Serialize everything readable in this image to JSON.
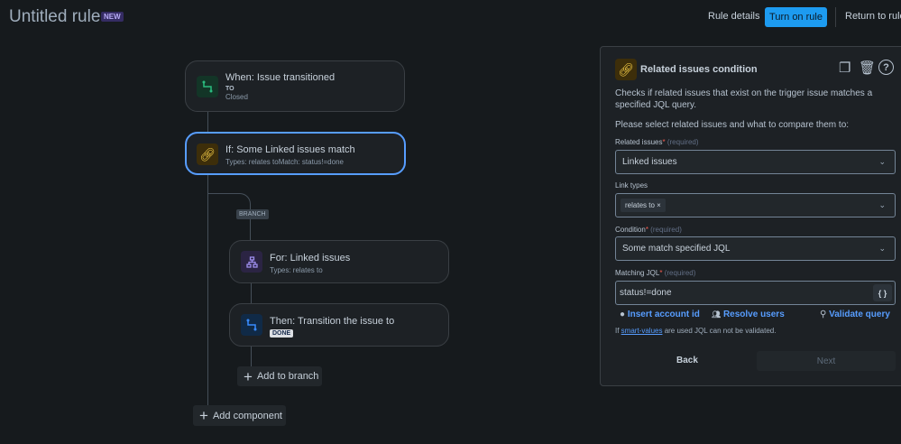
{
  "header": {
    "title": "Untitled rule",
    "badge": "NEW",
    "rule_details": "Rule details",
    "turn_on": "Turn on rule",
    "return": "Return to rules"
  },
  "flow": {
    "trigger": {
      "title": "When: Issue transitioned",
      "sub1": "TO",
      "sub2": "Closed"
    },
    "condition": {
      "title": "If: Some Linked issues match",
      "sub": "Types: relates toMatch: status!=done"
    },
    "branch_label": "BRANCH",
    "for": {
      "title": "For: Linked issues",
      "sub": "Types: relates to"
    },
    "then": {
      "title": "Then: Transition the issue to",
      "status": "DONE"
    },
    "add_to_branch": "Add to branch",
    "add_component": "Add component"
  },
  "panel": {
    "title": "Related issues condition",
    "description": "Checks if related issues that exist on the trigger issue matches a specified JQL query.",
    "prompt": "Please select related issues and what to compare them to:",
    "related_label": "Related issues",
    "required": "(required)",
    "related_value": "Linked issues",
    "link_types_label": "Link types",
    "link_tag": "relates to",
    "condition_label": "Condition",
    "condition_value": "Some match specified JQL",
    "jql_label": "Matching JQL",
    "jql_value": "status!=done",
    "jql_btn": "{ }",
    "insert_account": "Insert account id",
    "resolve_users": "Resolve users",
    "validate": "Validate query",
    "note_pre": "If ",
    "note_link": "smart-values",
    "note_post": " are used JQL can not be validated.",
    "back": "Back",
    "next": "Next"
  }
}
